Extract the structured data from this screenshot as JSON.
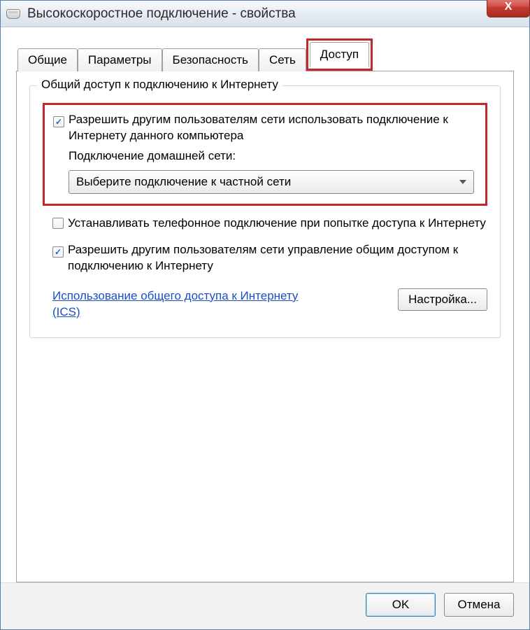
{
  "window": {
    "title": "Высокоскоростное подключение - свойства",
    "close_label": "X"
  },
  "tabs": {
    "items": [
      {
        "label": "Общие"
      },
      {
        "label": "Параметры"
      },
      {
        "label": "Безопасность"
      },
      {
        "label": "Сеть"
      },
      {
        "label": "Доступ"
      }
    ]
  },
  "group": {
    "title": "Общий доступ к подключению к Интернету"
  },
  "allow_share": {
    "checked": true,
    "label": "Разрешить другим пользователям сети использовать подключение к Интернету данного компьютера",
    "sub_label": "Подключение домашней сети:",
    "combo_value": "Выберите подключение к частной сети"
  },
  "dial_on_demand": {
    "checked": false,
    "label": "Устанавливать телефонное подключение при попытке доступа к Интернету"
  },
  "allow_control": {
    "checked": true,
    "label": "Разрешить другим пользователям сети управление общим доступом к подключению к Интернету"
  },
  "ics_link": "Использование общего доступа к Интернету (ICS)",
  "settings_button": "Настройка...",
  "footer": {
    "ok": "OK",
    "cancel": "Отмена"
  }
}
